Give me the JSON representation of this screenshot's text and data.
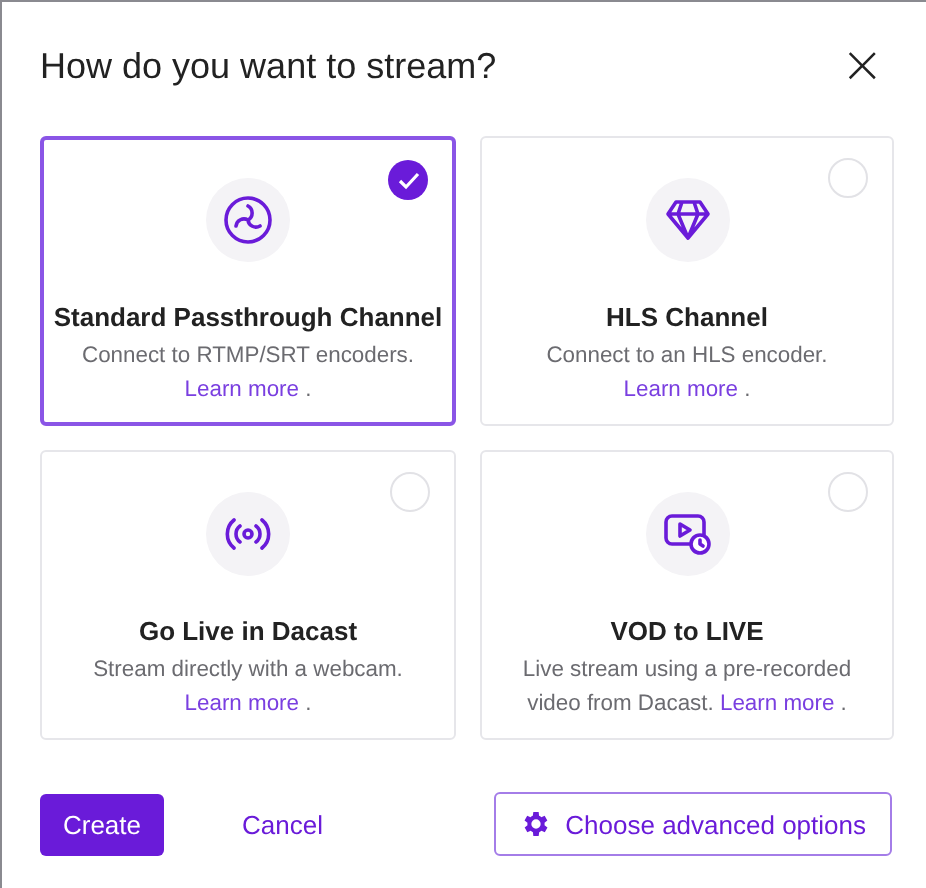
{
  "dialog": {
    "title": "How do you want to stream?",
    "close": "×"
  },
  "options": [
    {
      "title": "Standard Passthrough Channel",
      "description": "Connect to RTMP/SRT encoders.",
      "link": "Learn more",
      "suffix": ".",
      "selected": true
    },
    {
      "title": "HLS Channel",
      "description": "Connect to an HLS encoder.",
      "link": "Learn more",
      "suffix": ".",
      "selected": false
    },
    {
      "title": "Go Live in Dacast",
      "description": "Stream directly with a webcam.",
      "link": "Learn more",
      "suffix": ".",
      "selected": false
    },
    {
      "title": "VOD to LIVE",
      "description": "Live stream using a pre-recorded video from Dacast.",
      "link": "Learn more",
      "suffix": ".",
      "selected": false
    }
  ],
  "buttons": {
    "create": "Create",
    "cancel": "Cancel",
    "advanced": "Choose advanced options"
  }
}
